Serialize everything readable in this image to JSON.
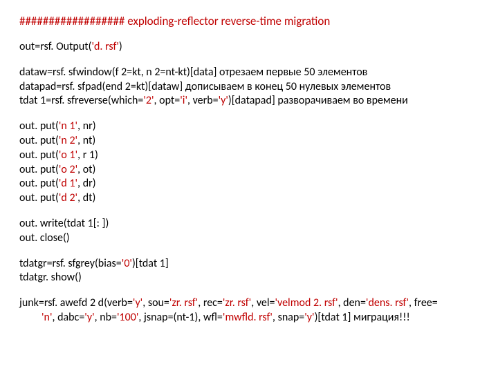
{
  "heading": {
    "hashes": "################## ",
    "text": "exploding-reflector reverse-time migration"
  },
  "out_line": {
    "p1": "out=rsf. Output(",
    "s1": "'d. rsf'",
    "p2": ")"
  },
  "block2": {
    "l1": "dataw=rsf. sfwindow(f 2=kt, n 2=nt-kt)[data] отрезаем первые 50 элементов",
    "l2": "datapad=rsf. sfpad(end 2=kt)[dataw] дописываем в конец 50 нулевых элементов",
    "l3": {
      "p1": "tdat 1=rsf. sfreverse(which=",
      "s1": "'2'",
      "p2": ", opt=",
      "s2": "'i'",
      "p3": ", verb=",
      "s3": "'y'",
      "p4": ")[datapad] разворачиваем во времени"
    }
  },
  "puts": {
    "l1": {
      "p1": "out. put(",
      "s1": "'n 1'",
      "p2": ", nr)"
    },
    "l2": {
      "p1": "out. put(",
      "s1": "'n 2'",
      "p2": ", nt)"
    },
    "l3": {
      "p1": "out. put(",
      "s1": "'o 1'",
      "p2": ", r 1)"
    },
    "l4": {
      "p1": "out. put(",
      "s1": "'o 2'",
      "p2": ", ot)"
    },
    "l5": {
      "p1": "out. put(",
      "s1": "'d 1'",
      "p2": ", dr)"
    },
    "l6": {
      "p1": "out. put(",
      "s1": "'d 2'",
      "p2": ", dt)"
    }
  },
  "write_block": {
    "l1": "out. write(tdat 1[: ])",
    "l2": "out. close()"
  },
  "grey_block": {
    "l1": {
      "p1": "tdatgr=rsf. sfgrey(bias=",
      "s1": "'0'",
      "p2": ")[tdat 1]"
    },
    "l2": "tdatgr. show()"
  },
  "junk": {
    "p1": "junk=rsf. awefd 2 d(verb=",
    "s1": "'y'",
    "p2": ", sou=",
    "s2": "'zr. rsf'",
    "p3": ", rec=",
    "s3": "'zr. rsf'",
    "p4": ", vel=",
    "s4": "'velmod 2. rsf'",
    "p5": ", den=",
    "s5": "'dens. rsf'",
    "p6": ", free=",
    "s6": "'n'",
    "p7": ", dabc=",
    "s7": "'y'",
    "p8": ", nb=",
    "s8": "'100'",
    "p9": ", jsnap=(nt-1), wfl=",
    "s9": "'mwfld. rsf'",
    "p10": ", snap=",
    "s10": "'y'",
    "p11": ")[tdat 1] миграция!!!"
  }
}
